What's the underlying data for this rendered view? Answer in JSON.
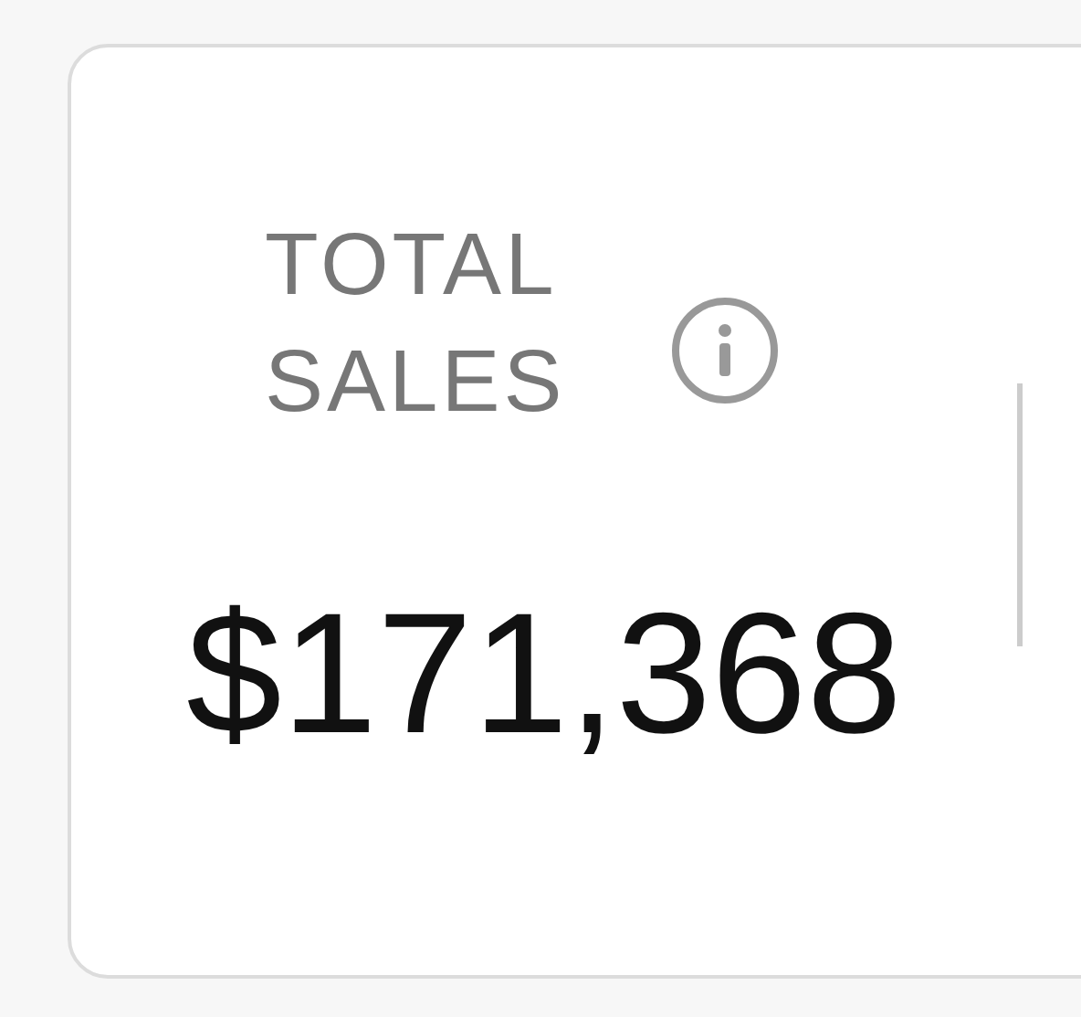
{
  "card": {
    "label": "TOTAL SALES",
    "value": "$171,368"
  }
}
